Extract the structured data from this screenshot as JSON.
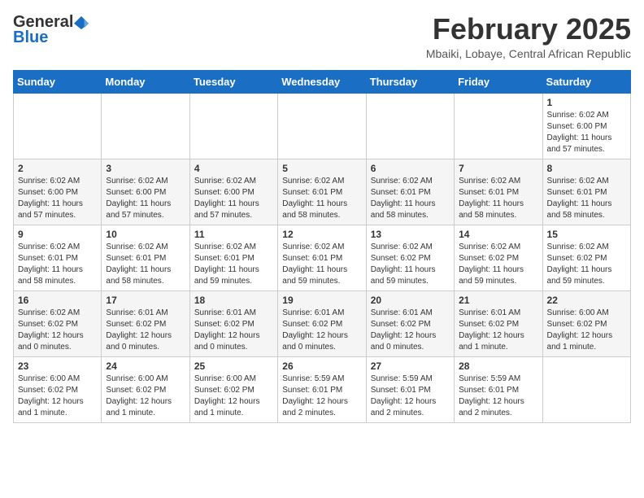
{
  "header": {
    "logo": {
      "general": "General",
      "blue": "Blue",
      "tagline": ""
    },
    "title": "February 2025",
    "location": "Mbaiki, Lobaye, Central African Republic"
  },
  "weekdays": [
    "Sunday",
    "Monday",
    "Tuesday",
    "Wednesday",
    "Thursday",
    "Friday",
    "Saturday"
  ],
  "weeks": [
    [
      {
        "day": "",
        "info": ""
      },
      {
        "day": "",
        "info": ""
      },
      {
        "day": "",
        "info": ""
      },
      {
        "day": "",
        "info": ""
      },
      {
        "day": "",
        "info": ""
      },
      {
        "day": "",
        "info": ""
      },
      {
        "day": "1",
        "info": "Sunrise: 6:02 AM\nSunset: 6:00 PM\nDaylight: 11 hours and 57 minutes."
      }
    ],
    [
      {
        "day": "2",
        "info": "Sunrise: 6:02 AM\nSunset: 6:00 PM\nDaylight: 11 hours and 57 minutes."
      },
      {
        "day": "3",
        "info": "Sunrise: 6:02 AM\nSunset: 6:00 PM\nDaylight: 11 hours and 57 minutes."
      },
      {
        "day": "4",
        "info": "Sunrise: 6:02 AM\nSunset: 6:00 PM\nDaylight: 11 hours and 57 minutes."
      },
      {
        "day": "5",
        "info": "Sunrise: 6:02 AM\nSunset: 6:01 PM\nDaylight: 11 hours and 58 minutes."
      },
      {
        "day": "6",
        "info": "Sunrise: 6:02 AM\nSunset: 6:01 PM\nDaylight: 11 hours and 58 minutes."
      },
      {
        "day": "7",
        "info": "Sunrise: 6:02 AM\nSunset: 6:01 PM\nDaylight: 11 hours and 58 minutes."
      },
      {
        "day": "8",
        "info": "Sunrise: 6:02 AM\nSunset: 6:01 PM\nDaylight: 11 hours and 58 minutes."
      }
    ],
    [
      {
        "day": "9",
        "info": "Sunrise: 6:02 AM\nSunset: 6:01 PM\nDaylight: 11 hours and 58 minutes."
      },
      {
        "day": "10",
        "info": "Sunrise: 6:02 AM\nSunset: 6:01 PM\nDaylight: 11 hours and 58 minutes."
      },
      {
        "day": "11",
        "info": "Sunrise: 6:02 AM\nSunset: 6:01 PM\nDaylight: 11 hours and 59 minutes."
      },
      {
        "day": "12",
        "info": "Sunrise: 6:02 AM\nSunset: 6:01 PM\nDaylight: 11 hours and 59 minutes."
      },
      {
        "day": "13",
        "info": "Sunrise: 6:02 AM\nSunset: 6:02 PM\nDaylight: 11 hours and 59 minutes."
      },
      {
        "day": "14",
        "info": "Sunrise: 6:02 AM\nSunset: 6:02 PM\nDaylight: 11 hours and 59 minutes."
      },
      {
        "day": "15",
        "info": "Sunrise: 6:02 AM\nSunset: 6:02 PM\nDaylight: 11 hours and 59 minutes."
      }
    ],
    [
      {
        "day": "16",
        "info": "Sunrise: 6:02 AM\nSunset: 6:02 PM\nDaylight: 12 hours and 0 minutes."
      },
      {
        "day": "17",
        "info": "Sunrise: 6:01 AM\nSunset: 6:02 PM\nDaylight: 12 hours and 0 minutes."
      },
      {
        "day": "18",
        "info": "Sunrise: 6:01 AM\nSunset: 6:02 PM\nDaylight: 12 hours and 0 minutes."
      },
      {
        "day": "19",
        "info": "Sunrise: 6:01 AM\nSunset: 6:02 PM\nDaylight: 12 hours and 0 minutes."
      },
      {
        "day": "20",
        "info": "Sunrise: 6:01 AM\nSunset: 6:02 PM\nDaylight: 12 hours and 0 minutes."
      },
      {
        "day": "21",
        "info": "Sunrise: 6:01 AM\nSunset: 6:02 PM\nDaylight: 12 hours and 1 minute."
      },
      {
        "day": "22",
        "info": "Sunrise: 6:00 AM\nSunset: 6:02 PM\nDaylight: 12 hours and 1 minute."
      }
    ],
    [
      {
        "day": "23",
        "info": "Sunrise: 6:00 AM\nSunset: 6:02 PM\nDaylight: 12 hours and 1 minute."
      },
      {
        "day": "24",
        "info": "Sunrise: 6:00 AM\nSunset: 6:02 PM\nDaylight: 12 hours and 1 minute."
      },
      {
        "day": "25",
        "info": "Sunrise: 6:00 AM\nSunset: 6:02 PM\nDaylight: 12 hours and 1 minute."
      },
      {
        "day": "26",
        "info": "Sunrise: 5:59 AM\nSunset: 6:01 PM\nDaylight: 12 hours and 2 minutes."
      },
      {
        "day": "27",
        "info": "Sunrise: 5:59 AM\nSunset: 6:01 PM\nDaylight: 12 hours and 2 minutes."
      },
      {
        "day": "28",
        "info": "Sunrise: 5:59 AM\nSunset: 6:01 PM\nDaylight: 12 hours and 2 minutes."
      },
      {
        "day": "",
        "info": ""
      }
    ]
  ]
}
